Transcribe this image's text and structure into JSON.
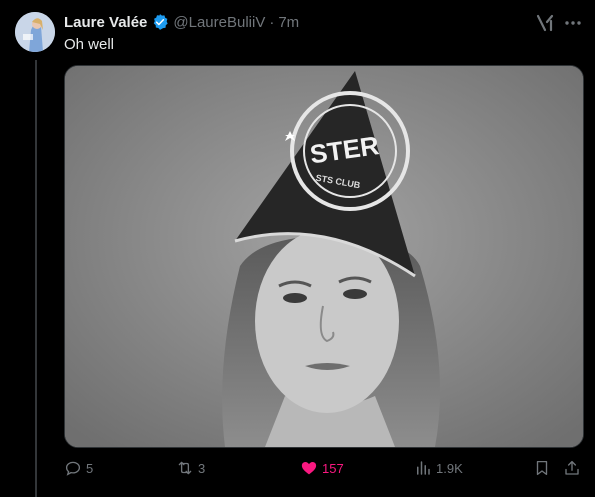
{
  "tweet": {
    "display_name": "Laure Valée",
    "handle": "@LaureBuliiV",
    "separator": "·",
    "time": "7m",
    "text": "Oh well",
    "verified": true
  },
  "media": {
    "hat_text": "STER",
    "hat_subtext": "STS CLUB",
    "style": "black-and-white photo"
  },
  "actions": {
    "replies": "5",
    "reposts": "3",
    "likes": "157",
    "views": "1.9K",
    "liked": true
  },
  "colors": {
    "background": "#000000",
    "text": "#e7e9ea",
    "muted": "#71767b",
    "verified": "#1d9bf0",
    "like": "#f91880"
  }
}
